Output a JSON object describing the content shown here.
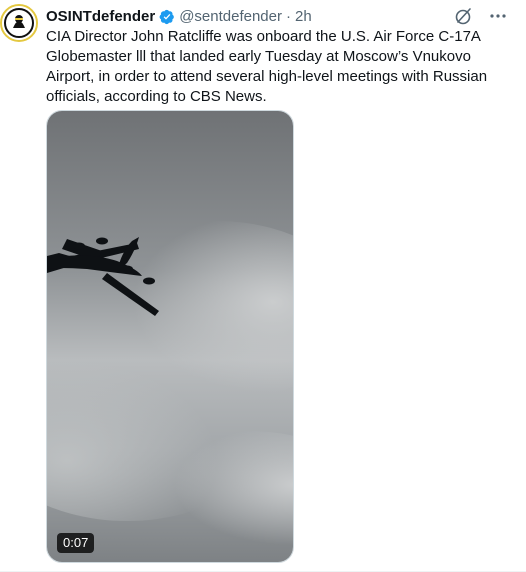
{
  "tweet": {
    "display_name": "OSINTdefender",
    "handle": "@sentdefender",
    "separator": "·",
    "time": "2h",
    "text": "CIA Director John Ratcliffe was onboard the U.S. Air Force C-17A Globemaster lll that landed early Tuesday at Moscow’s Vnukovo Airport, in order to attend several high-level meetings with Russian officials, according to CBS News.",
    "verified_color": "#1d9bf0"
  },
  "media": {
    "duration": "0:07"
  },
  "icons": {
    "avatar": "osint-logo",
    "verified": "verified-badge-icon",
    "grok": "grok-icon",
    "more": "more-options-icon"
  }
}
